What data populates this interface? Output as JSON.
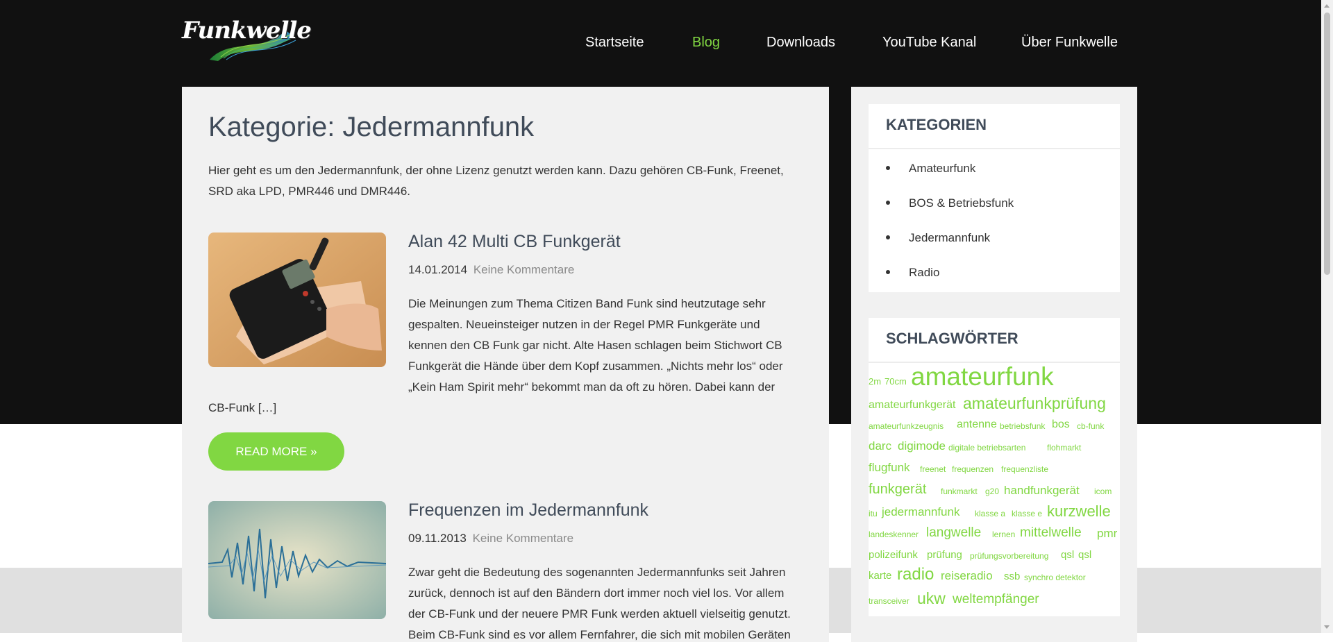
{
  "site": {
    "logo_text": "Funkwelle"
  },
  "nav": {
    "items": [
      {
        "label": "Startseite"
      },
      {
        "label": "Blog"
      },
      {
        "label": "Downloads"
      },
      {
        "label": "YouTube Kanal"
      },
      {
        "label": "Über Funkwelle"
      }
    ],
    "active_color": "#81d742"
  },
  "main": {
    "title": "Kategorie: Jedermannfunk",
    "description": "Hier geht es um den Jedermannfunk, der ohne Lizenz genutzt werden kann. Dazu gehören CB-Funk, Freenet, SRD aka LPD, PMR446 und DMR446.",
    "posts": [
      {
        "title": "Alan 42 Multi CB Funkgerät",
        "date": "14.01.2014",
        "comments": "Keine Kommentare",
        "excerpt_lines": [
          "Die Meinungen zum Thema Citizen Band Funk sind heutzutage sehr",
          "gespalten. Neueinsteiger nutzen in der Regel PMR Funkgeräte und",
          "kennen den CB Funk gar nicht. Alte Hasen schlagen beim Stichwort CB",
          "Funkgerät die Hände über dem Kopf zusammen. „Nichts mehr los“ oder",
          "„Kein Ham Spirit mehr“ bekommt man da oft zu hören. Dabei kann der",
          "CB-Funk […]"
        ],
        "read_more": "READ MORE »"
      },
      {
        "title": "Frequenzen im Jedermannfunk",
        "date": "09.11.2013",
        "comments": "Keine Kommentare",
        "excerpt_lines": [
          "Zwar geht die Bedeutung des sogenannten Jedermannfunks seit Jahren",
          "zurück, dennoch ist auf den Bändern dort immer noch viel los. Vor allem",
          "der CB-Funk und der neuere PMR Funk werden aktuell vielseitig genutzt.",
          "Beim CB-Funk sind es vor allem Fernfahrer, die sich mit mobilen Geräten"
        ]
      }
    ]
  },
  "sidebar": {
    "categories": {
      "title": "KATEGORIEN",
      "items": [
        {
          "label": "Amateurfunk"
        },
        {
          "label": "BOS & Betriebsfunk"
        },
        {
          "label": "Jedermannfunk"
        },
        {
          "label": "Radio"
        }
      ]
    },
    "tags": {
      "title": "SCHLAGWÖRTER",
      "items": [
        "2m",
        "70cm",
        "amateurfunk",
        "amateurfunkgerät",
        "amateurfunkprüfung",
        "amateurfunkzeugnis",
        "antenne",
        "betriebsfunk",
        "bos",
        "cb-funk",
        "darc",
        "digimode",
        "digitale betriebsarten",
        "flohmarkt",
        "flugfunk",
        "freenet",
        "frequenzen",
        "frequenzliste",
        "funkgerät",
        "funkmarkt",
        "g20",
        "handfunkgerät",
        "icom",
        "itu",
        "jedermannfunk",
        "klasse a",
        "klasse e",
        "kurzwelle",
        "landeskenner",
        "langwelle",
        "lernen",
        "mittelwelle",
        "pmr",
        "polizeifunk",
        "prüfung",
        "prüfungsvorbereitung",
        "qsl",
        "qsl",
        "karte",
        "radio",
        "reiseradio",
        "ssb",
        "synchro detektor",
        "transceiver",
        "ukw",
        "weltempfänger"
      ],
      "color": "#81d742"
    }
  },
  "colors": {
    "accent": "#81d742",
    "header_bg": "#111111",
    "panel_bg": "#f1f1f1",
    "heading": "#404b59"
  }
}
